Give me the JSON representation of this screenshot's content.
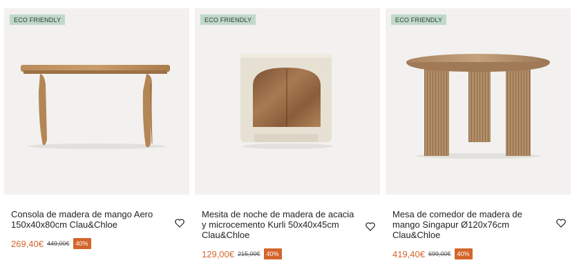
{
  "colors": {
    "badge_bg": "#bfd9c9",
    "price": "#d3652b",
    "discount_bg": "#d3652b",
    "image_bg": "#f2f1ef"
  },
  "products": [
    {
      "badge": "ECO FRIENDLY",
      "title": "Consola de madera de mango Aero 150x40x80cm Clau&Chloe",
      "price": "269,40€",
      "old_price": "449,00€",
      "discount": "40%",
      "wishlist_icon": "heart-icon"
    },
    {
      "badge": "ECO FRIENDLY",
      "title": "Mesita de noche de madera de acacia y microcemento Kurli 50x40x45cm Clau&Chloe",
      "price": "129,00€",
      "old_price": "215,00€",
      "discount": "40%",
      "wishlist_icon": "heart-icon"
    },
    {
      "badge": "ECO FRIENDLY",
      "title": "Mesa de comedor de madera de mango Singapur Ø120x76cm Clau&Chloe",
      "price": "419,40€",
      "old_price": "699,00€",
      "discount": "40%",
      "wishlist_icon": "heart-icon"
    }
  ]
}
